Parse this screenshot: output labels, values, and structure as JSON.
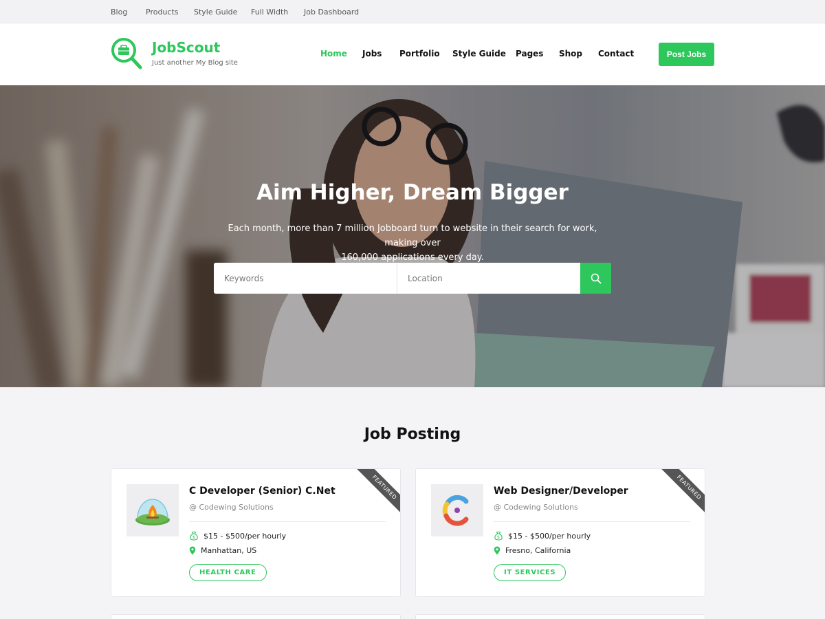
{
  "topbar": {
    "links": [
      "Blog",
      "Products",
      "Style Guide",
      "Full Width",
      "Job Dashboard"
    ]
  },
  "header": {
    "site_title": "JobScout",
    "tagline": "Just another My Blog site",
    "nav": [
      "Home",
      "Jobs",
      "Portfolio",
      "Style Guide",
      "Pages",
      "Shop",
      "Contact"
    ],
    "active_nav": "Home",
    "cta_label": "Post Jobs"
  },
  "hero": {
    "title": "Aim Higher, Dream Bigger",
    "subtitle_line1": "Each month, more than 7 million Jobboard turn to website in their search for work, making over",
    "subtitle_line2": "160,000 applications every day.",
    "search": {
      "keywords_placeholder": "Keywords",
      "location_placeholder": "Location",
      "icon": "search-icon"
    }
  },
  "jobs_section": {
    "title": "Job Posting",
    "cards": [
      {
        "title": "C Developer (Senior) C.Net",
        "company": "@ Codewing Solutions",
        "salary": "$15 - $500/per hourly",
        "location": "Manhattan, US",
        "tag": "HEALTH CARE",
        "ribbon": "FEATURED",
        "logo_icon": "campfire-dome-icon"
      },
      {
        "title": "Web Designer/Developer",
        "company": "@ Codewing Solutions",
        "salary": "$15 - $500/per hourly",
        "location": "Fresno, California",
        "tag": "IT SERVICES",
        "ribbon": "FEATURED",
        "logo_icon": "letter-c-logo-icon"
      }
    ]
  },
  "colors": {
    "brand_green": "#2dc75c",
    "ribbon_gray": "#555555",
    "page_bg": "#f4f4f6"
  }
}
